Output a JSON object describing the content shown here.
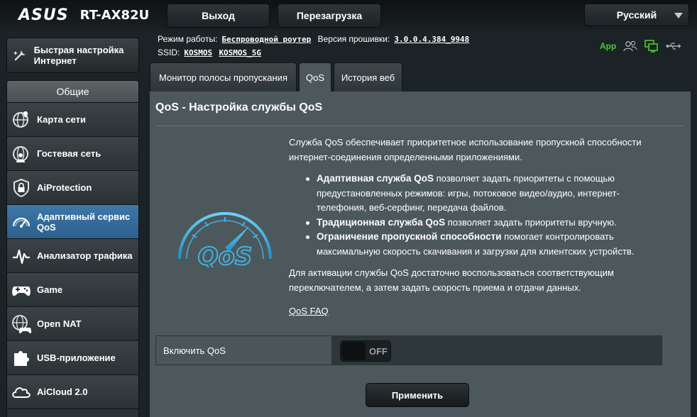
{
  "header": {
    "brand": "ASUS",
    "model": "RT-AX82U",
    "logout_label": "Выход",
    "reboot_label": "Перезагрузка",
    "language": "Русский"
  },
  "info": {
    "mode_label": "Режим работы:",
    "mode_value": "Беспроводной роутер",
    "firmware_label": "Версия прошивки:",
    "firmware_value": "3.0.0.4.384_9948",
    "ssid_label": "SSID:",
    "ssid_1": "KOSMOS",
    "ssid_2": "KOSMOS_5G",
    "app_label": "App"
  },
  "sidebar": {
    "quick_setup": "Быстрая настройка Интернет",
    "section_title": "Общие",
    "items": [
      {
        "label": "Карта сети",
        "icon": "globe-map-icon"
      },
      {
        "label": "Гостевая сеть",
        "icon": "globe-users-icon"
      },
      {
        "label": "AiProtection",
        "icon": "shield-lock-icon"
      },
      {
        "label": "Адаптивный сервис QoS",
        "icon": "speedometer-icon",
        "active": true
      },
      {
        "label": "Анализатор трафика",
        "icon": "pulse-chart-icon"
      },
      {
        "label": "Game",
        "icon": "gamepad-icon"
      },
      {
        "label": "Open NAT",
        "icon": "globe-gamepad-icon"
      },
      {
        "label": "USB-приложение",
        "icon": "puzzle-icon"
      },
      {
        "label": "AiCloud 2.0",
        "icon": "cloud-icon"
      }
    ]
  },
  "tabs": [
    {
      "label": "Монитор полосы пропускания"
    },
    {
      "label": "QoS",
      "active": true
    },
    {
      "label": "История веб"
    }
  ],
  "main": {
    "title": "QoS - Настройка службы QoS",
    "logo_text": "QoS",
    "intro": "Служба QoS обеспечивает приоритетное использование пропускной способности интернет-соединения определенными приложениями.",
    "bullets": [
      {
        "bold": "Адаптивная служба QoS",
        "text": " позволяет задать приоритеты с помощью предустановленных режимов: игры, потоковое видео/аудио, интернет-телефония, веб-серфинг, передача файлов."
      },
      {
        "bold": "Традиционная служба QoS",
        "text": " позволяет задать приоритеты вручную."
      },
      {
        "bold": "Ограничение пропускной способности",
        "text": " помогает контролировать максимальную скорость скачивания и загрузки для клиентских устройств."
      }
    ],
    "activation_text": "Для активации службы QoS достаточно воспользоваться соответствующим переключателем, а затем задать скорость приема и отдачи данных.",
    "faq_link": "QoS FAQ",
    "enable_label": "Включить QoS",
    "toggle_state": "OFF",
    "apply_label": "Применить"
  },
  "colors": {
    "accent_active": "#3d78a8",
    "panel_bg": "#4d585c",
    "app_green": "#4ecb2e",
    "qos_blue": "#3fb2e3"
  }
}
